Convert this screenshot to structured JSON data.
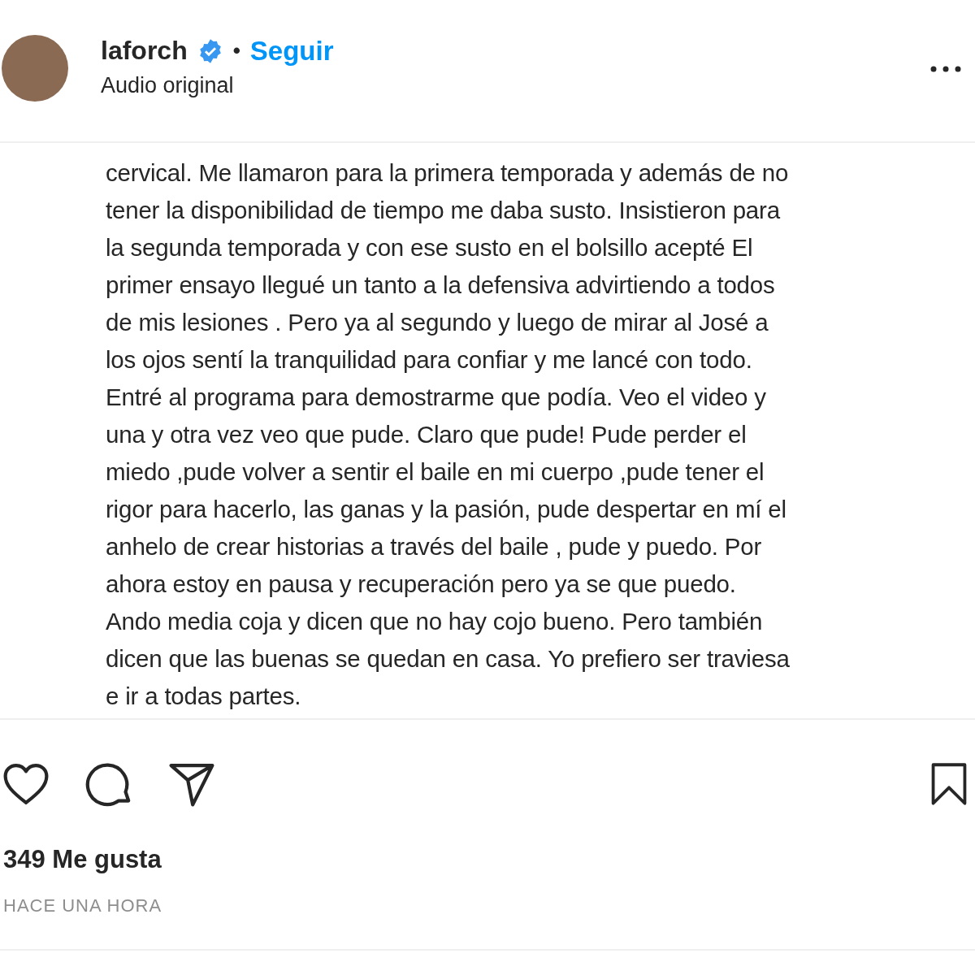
{
  "header": {
    "username": "laforch",
    "verified": true,
    "separator": "•",
    "follow": "Seguir",
    "subtitle": "Audio original"
  },
  "caption_lines": [
    "cervical. Me llamaron para la primera temporada y además de no",
    "tener la disponibilidad de tiempo me daba susto. Insistieron para",
    "la segunda temporada y con ese susto en el bolsillo acepté El",
    "primer ensayo llegué un tanto a la defensiva advirtiendo a todos",
    "de mis lesiones . Pero ya al segundo y luego de mirar al José a",
    "los ojos sentí la tranquilidad para confiar y me lancé con todo.",
    "Entré al programa para demostrarme que podía. Veo el video y",
    "una y otra vez veo que pude. Claro que pude! Pude perder el",
    "miedo ,pude volver a sentir el baile en mi cuerpo ,pude tener el",
    "rigor para hacerlo, las ganas y la pasión, pude despertar en mí el",
    "anhelo de crear historias a través del baile , pude y puedo. Por",
    "ahora estoy en pausa y recuperación pero ya se que puedo.",
    "Ando media coja y dicen que no hay cojo bueno. Pero también",
    "dicen que las buenas se quedan en casa. Yo prefiero ser traviesa",
    "e ir a todas partes."
  ],
  "actions": {
    "liked": false,
    "saved": false
  },
  "likes": "349 Me gusta",
  "time": "HACE UNA HORA"
}
